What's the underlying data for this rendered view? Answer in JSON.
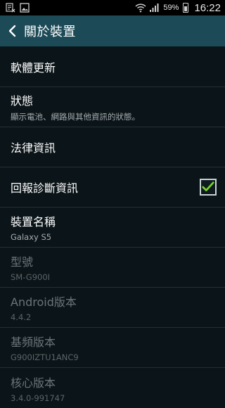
{
  "status_bar": {
    "icons": [
      "usb-debug-icon",
      "image-icon",
      "wifi-icon",
      "signal-icon",
      "battery-icon"
    ],
    "battery_percent": "59%",
    "battery_level": 0.59,
    "time": "16:22"
  },
  "header": {
    "title": "關於裝置",
    "back_icon": "chevron-left-icon"
  },
  "colors": {
    "appbar": "#1c4a56",
    "background": "#0b1418",
    "check": "#7ad12b"
  },
  "items": [
    {
      "title": "軟體更新",
      "subtitle": ""
    },
    {
      "title": "狀態",
      "subtitle": "顯示電池、網路與其他資訊的狀態。"
    },
    {
      "title": "法律資訊",
      "subtitle": ""
    },
    {
      "title": "回報診斷資訊",
      "subtitle": "",
      "checked": true
    },
    {
      "title": "裝置名稱",
      "subtitle": "Galaxy S5"
    },
    {
      "title": "型號",
      "subtitle": "SM-G900I"
    },
    {
      "title": "Android版本",
      "subtitle": "4.4.2"
    },
    {
      "title": "基頻版本",
      "subtitle": "G900IZTU1ANC9"
    },
    {
      "title": "核心版本",
      "subtitle": "3.4.0-991747"
    }
  ]
}
